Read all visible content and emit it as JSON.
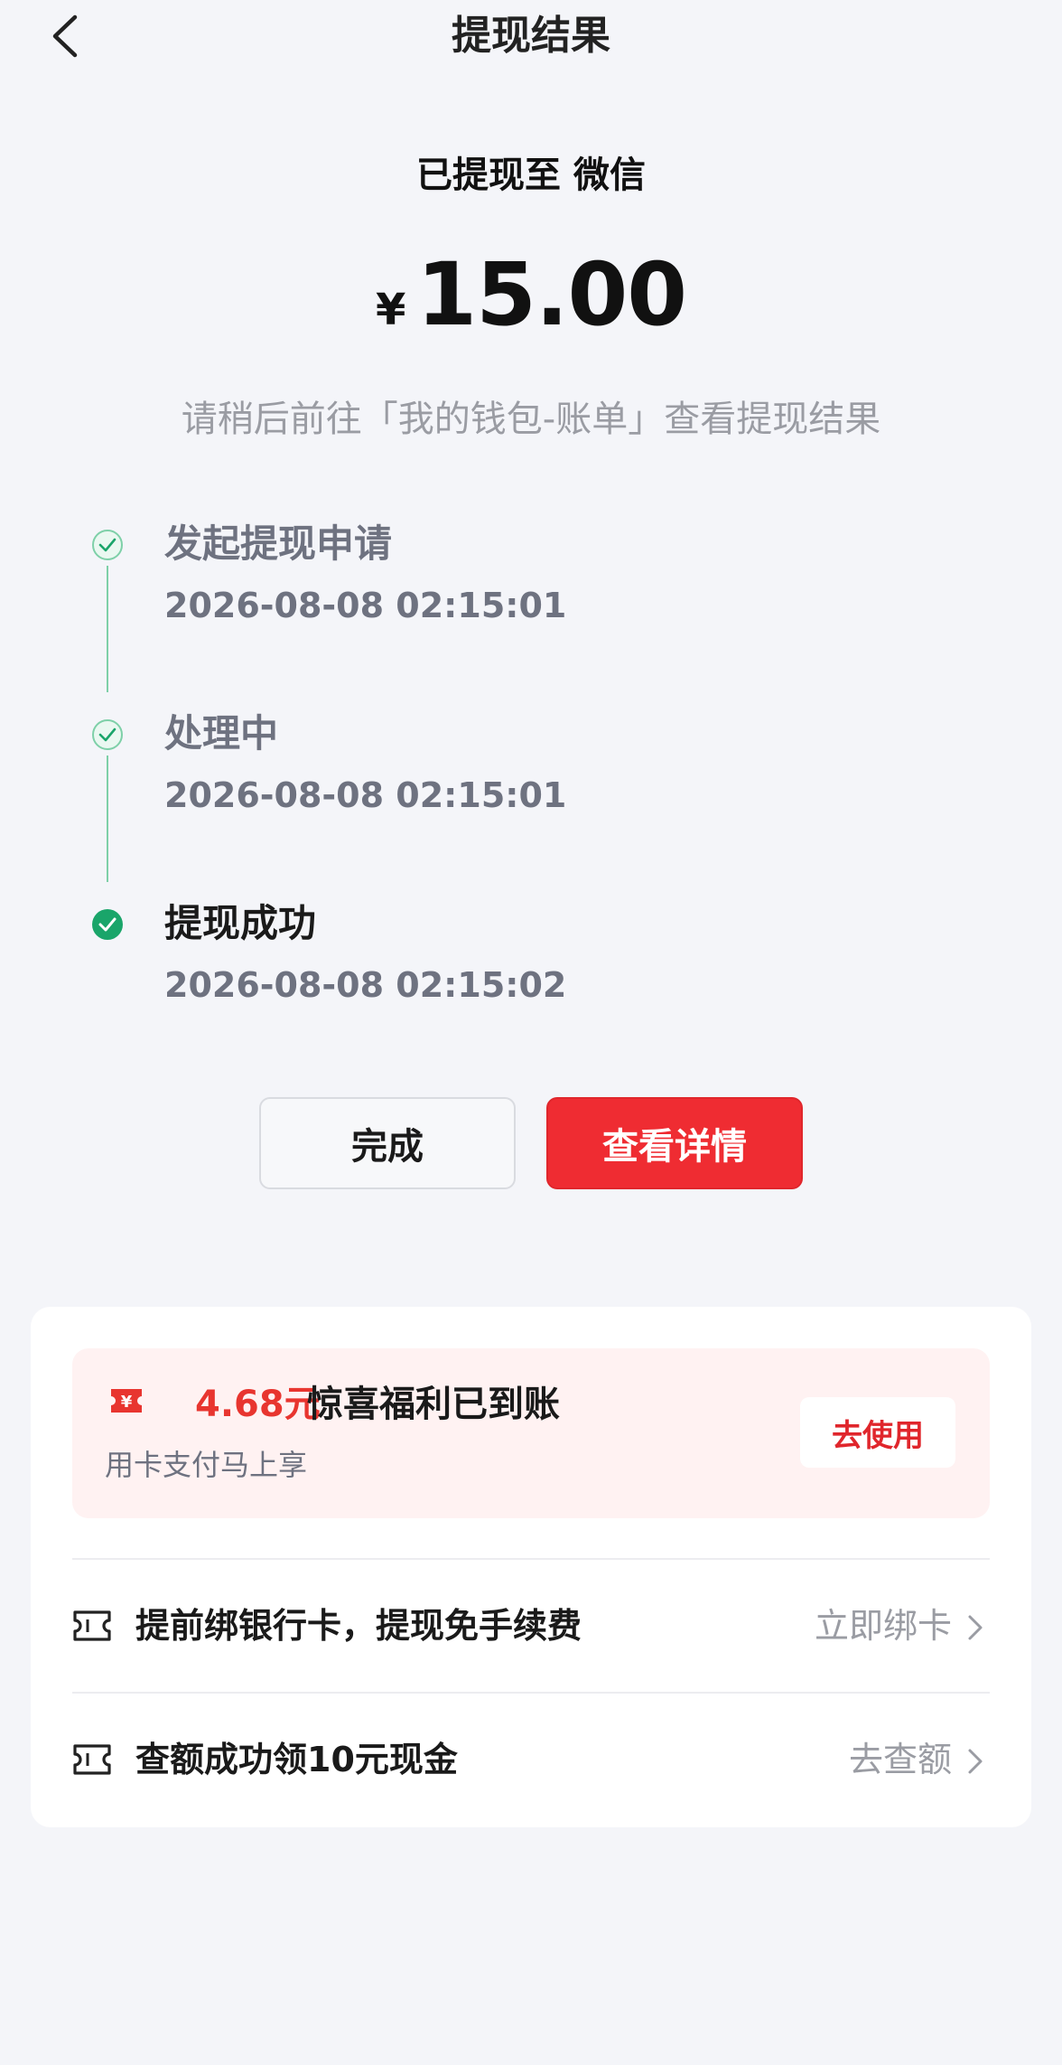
{
  "nav": {
    "title": "提现结果",
    "back_icon": "chevron-left-icon"
  },
  "result": {
    "headline": "已提现至 微信",
    "currency": "¥",
    "amount": "15.00",
    "hint": "请稍后前往「我的钱包-账单」查看提现结果"
  },
  "timeline": [
    {
      "title": "发起提现申请",
      "time": "2026-08-08 02:15:01",
      "state": "done"
    },
    {
      "title": "处理中",
      "time": "2026-08-08 02:15:01",
      "state": "done"
    },
    {
      "title": "提现成功",
      "time": "2026-08-08 02:15:02",
      "state": "success"
    }
  ],
  "buttons": {
    "done": "完成",
    "detail": "查看详情"
  },
  "promo": {
    "icon": "ticket-yuan-icon",
    "amount": "4.68元",
    "title": "惊喜福利已到账",
    "subtitle": "用卡支付马上享",
    "action": "去使用"
  },
  "offers": [
    {
      "icon": "ticket-icon",
      "label": "提前绑银行卡，提现免手续费",
      "action": "立即绑卡"
    },
    {
      "icon": "ticket-icon",
      "label": "查额成功领10元现金",
      "action": "去查额"
    }
  ],
  "colors": {
    "accent_red": "#ef2c32",
    "success_green": "#1aa56a",
    "line_green": "#7ed0a8",
    "background": "#f4f5f9"
  }
}
